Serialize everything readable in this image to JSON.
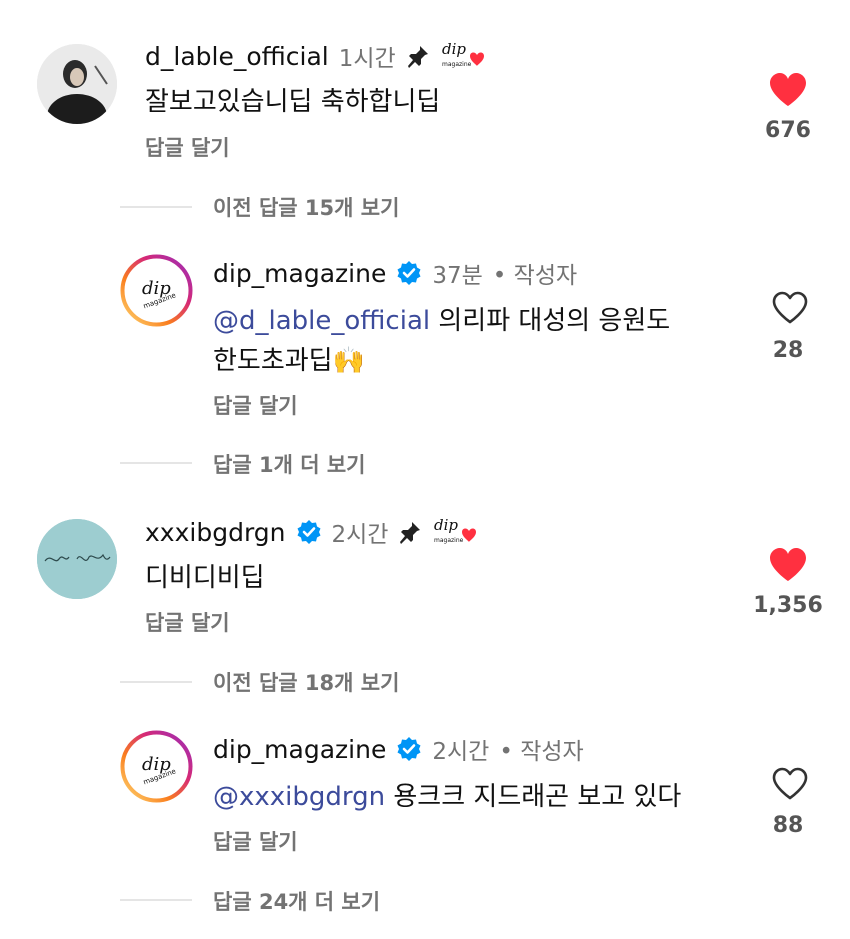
{
  "comments": [
    {
      "username": "d_lable_official",
      "time": "1시간",
      "text": "잘보고있습니딥 축하합니딥",
      "reply": "답글 달기",
      "likes": "676",
      "liked": true,
      "thread_link": "이전 답글 15개 보기",
      "replies": [
        {
          "username": "dip_magazine",
          "time": "37분",
          "author_label": "• 작성자",
          "mention": "@d_lable_official",
          "text_line1": " 의리파 대성의 응원도",
          "text_line2": "한도초과딥🙌",
          "reply": "답글 달기",
          "likes": "28",
          "liked": false,
          "more_link": "답글 1개 더 보기"
        }
      ]
    },
    {
      "username": "xxxibgdrgn",
      "time": "2시간",
      "text": "디비디비딥",
      "reply": "답글 달기",
      "likes": "1,356",
      "liked": true,
      "thread_link": "이전 답글 18개 보기",
      "replies": [
        {
          "username": "dip_magazine",
          "time": "2시간",
          "author_label": "• 작성자",
          "mention": "@xxxibgdrgn",
          "text_line1": " 용크크 지드래곤 보고 있다",
          "reply": "답글 달기",
          "likes": "88",
          "liked": false,
          "more_link": "답글 24개 더 보기"
        }
      ]
    }
  ],
  "colors": {
    "like_red": "#ff3040",
    "mention_blue": "#3c4b9b",
    "verified_blue": "#0095f6",
    "muted_gray": "#737373"
  },
  "icons": [
    "pin-icon",
    "verified-badge-icon",
    "heart-icon",
    "heart-outline-icon",
    "creator-liked-icon"
  ]
}
